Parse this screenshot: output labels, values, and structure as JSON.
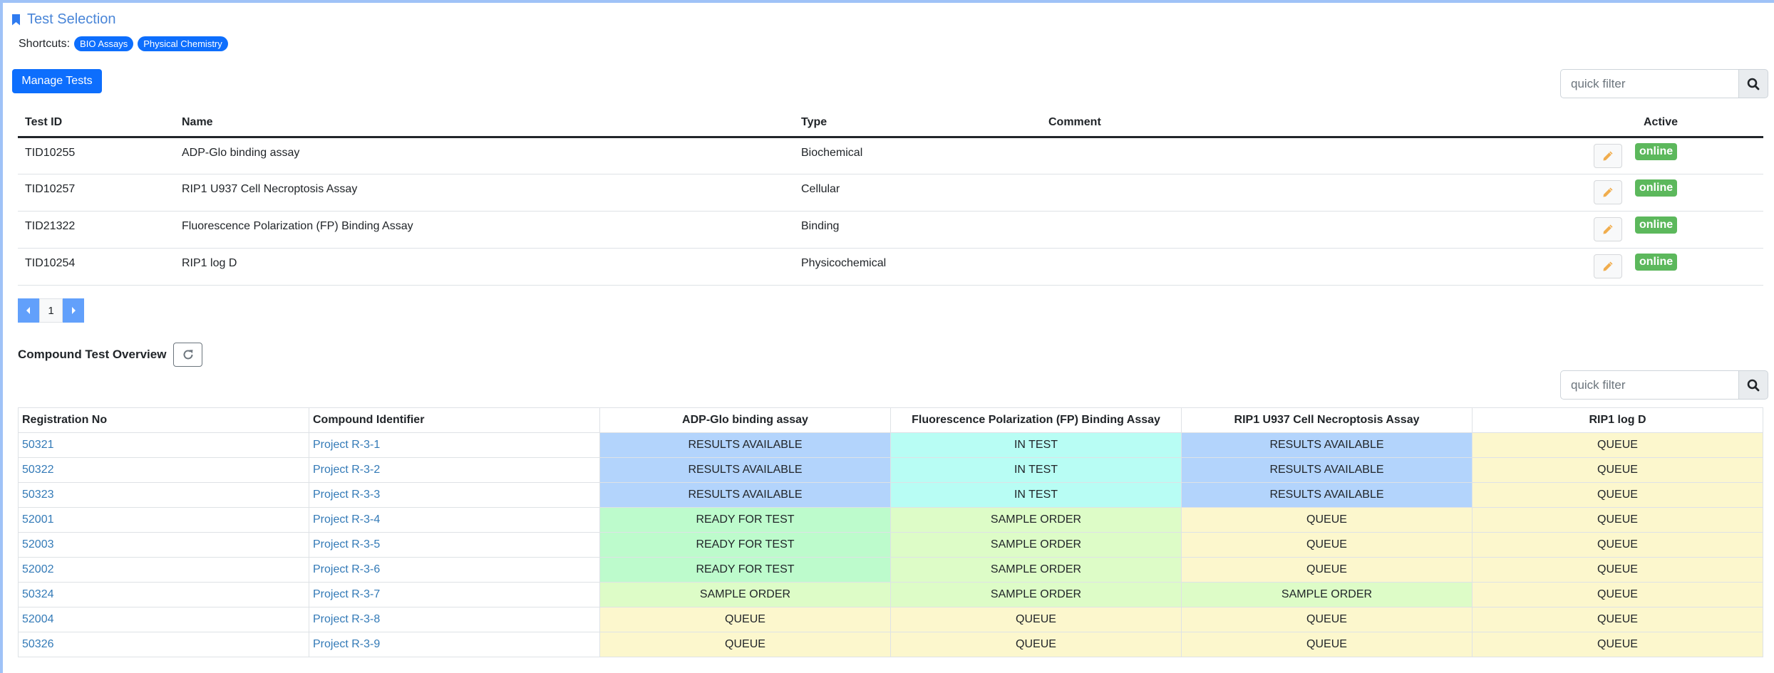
{
  "header": {
    "title": "Test Selection",
    "icon": "bookmark-icon"
  },
  "shortcuts": {
    "label": "Shortcuts:",
    "items": [
      "BIO Assays",
      "Physical Chemistry"
    ]
  },
  "toolbar": {
    "manage_label": "Manage Tests"
  },
  "quick_filter": {
    "placeholder": "quick filter"
  },
  "tests_table": {
    "columns": [
      "Test ID",
      "Name",
      "Type",
      "Comment",
      "Active"
    ],
    "rows": [
      {
        "id": "TID10255",
        "name": "ADP-Glo binding assay",
        "type": "Biochemical",
        "comment": "",
        "status": "online"
      },
      {
        "id": "TID10257",
        "name": "RIP1 U937 Cell Necroptosis Assay",
        "type": "Cellular",
        "comment": "",
        "status": "online"
      },
      {
        "id": "TID21322",
        "name": "Fluorescence Polarization (FP) Binding Assay",
        "type": "Binding",
        "comment": "",
        "status": "online"
      },
      {
        "id": "TID10254",
        "name": "RIP1 log D",
        "type": "Physicochemical",
        "comment": "",
        "status": "online"
      }
    ]
  },
  "pagination": {
    "current_page": "1"
  },
  "overview": {
    "title": "Compound Test Overview",
    "columns": [
      "Registration No",
      "Compound Identifier",
      "ADP-Glo binding assay",
      "Fluorescence Polarization (FP) Binding Assay",
      "RIP1 U937 Cell Necroptosis Assay",
      "RIP1 log D"
    ],
    "rows": [
      {
        "reg": "50321",
        "cid": "Project R-3-1",
        "s": [
          "RESULTS AVAILABLE",
          "IN TEST",
          "RESULTS AVAILABLE",
          "QUEUE"
        ]
      },
      {
        "reg": "50322",
        "cid": "Project R-3-2",
        "s": [
          "RESULTS AVAILABLE",
          "IN TEST",
          "RESULTS AVAILABLE",
          "QUEUE"
        ]
      },
      {
        "reg": "50323",
        "cid": "Project R-3-3",
        "s": [
          "RESULTS AVAILABLE",
          "IN TEST",
          "RESULTS AVAILABLE",
          "QUEUE"
        ]
      },
      {
        "reg": "52001",
        "cid": "Project R-3-4",
        "s": [
          "READY FOR TEST",
          "SAMPLE ORDER",
          "QUEUE",
          "QUEUE"
        ]
      },
      {
        "reg": "52003",
        "cid": "Project R-3-5",
        "s": [
          "READY FOR TEST",
          "SAMPLE ORDER",
          "QUEUE",
          "QUEUE"
        ]
      },
      {
        "reg": "52002",
        "cid": "Project R-3-6",
        "s": [
          "READY FOR TEST",
          "SAMPLE ORDER",
          "QUEUE",
          "QUEUE"
        ]
      },
      {
        "reg": "50324",
        "cid": "Project R-3-7",
        "s": [
          "SAMPLE ORDER",
          "SAMPLE ORDER",
          "SAMPLE ORDER",
          "QUEUE"
        ]
      },
      {
        "reg": "52004",
        "cid": "Project R-3-8",
        "s": [
          "QUEUE",
          "QUEUE",
          "QUEUE",
          "QUEUE"
        ]
      },
      {
        "reg": "50326",
        "cid": "Project R-3-9",
        "s": [
          "QUEUE",
          "QUEUE",
          "QUEUE",
          "QUEUE"
        ]
      }
    ],
    "status_colors": {
      "RESULTS AVAILABLE": "#b3d4fc",
      "IN TEST": "#b8fdf4",
      "READY FOR TEST": "#bdfbcc",
      "SAMPLE ORDER": "#ddfcc7",
      "QUEUE": "#fcf7cd"
    }
  },
  "colors": {
    "primary": "#0d6efd",
    "online": "#5cb85c",
    "link": "#337ab7",
    "title": "#4a86d8"
  }
}
